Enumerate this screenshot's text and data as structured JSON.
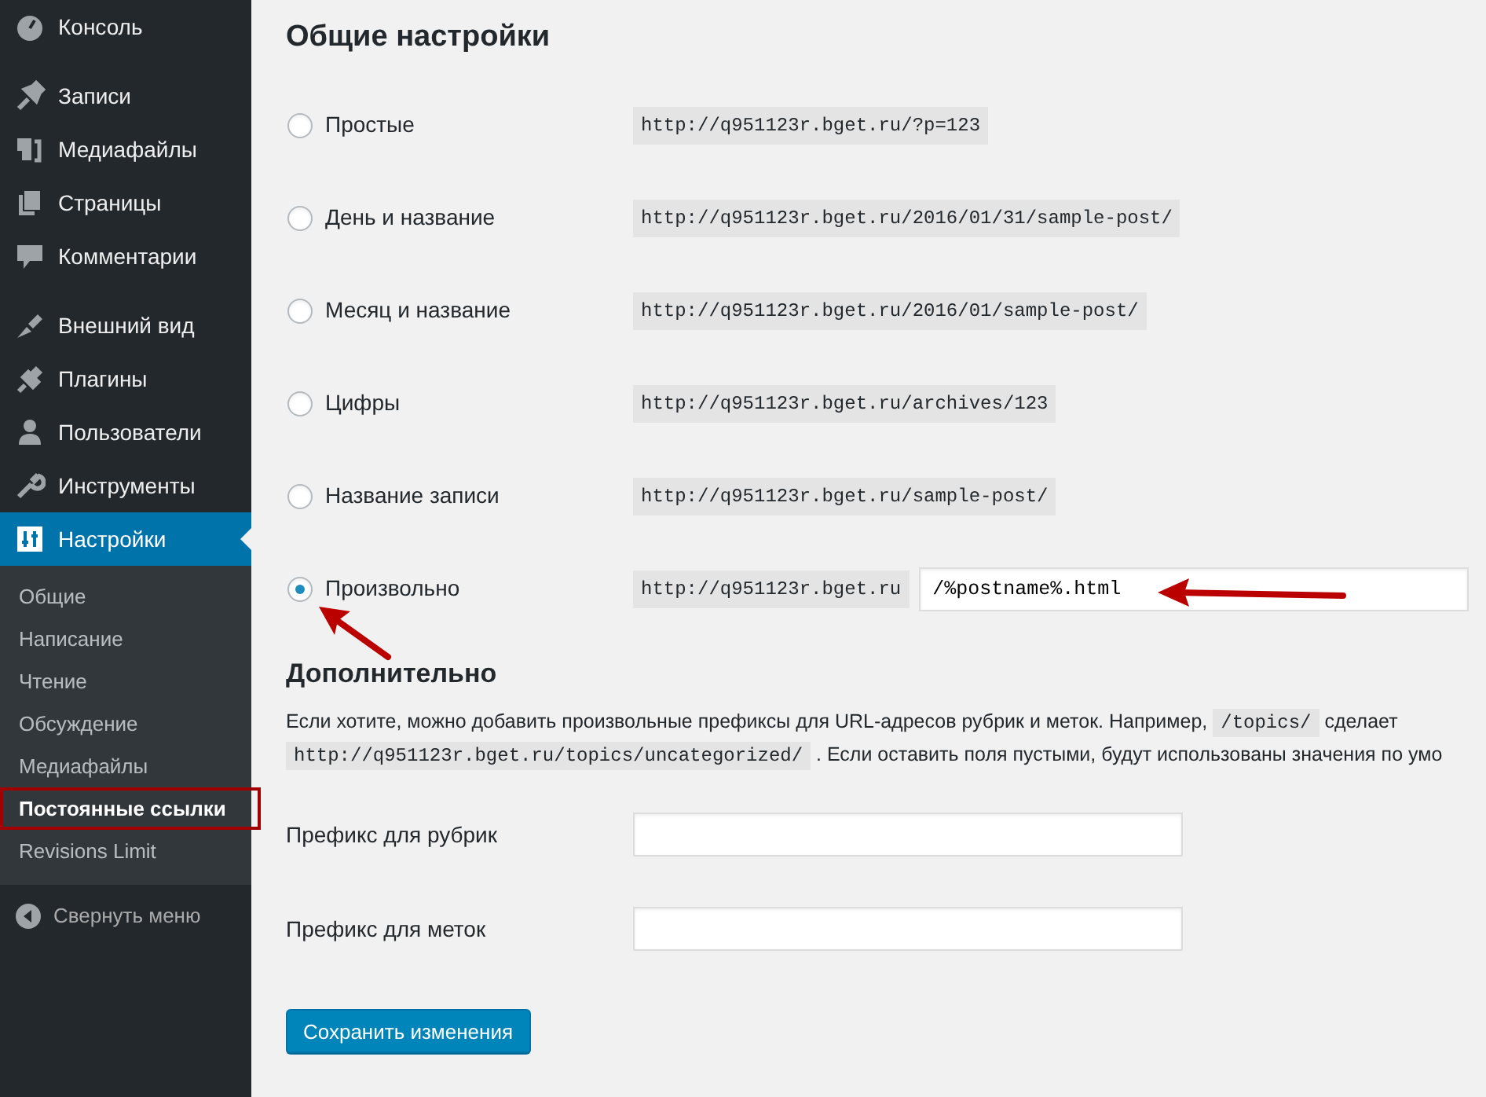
{
  "sidebar": {
    "menu_groups": [
      [
        {
          "label": "Консоль",
          "selected": false
        }
      ],
      [
        {
          "label": "Записи",
          "selected": false
        },
        {
          "label": "Медиафайлы",
          "selected": false
        },
        {
          "label": "Страницы",
          "selected": false
        },
        {
          "label": "Комментарии",
          "selected": false
        }
      ],
      [
        {
          "label": "Внешний вид",
          "selected": false
        },
        {
          "label": "Плагины",
          "selected": false
        },
        {
          "label": "Пользователи",
          "selected": false
        },
        {
          "label": "Инструменты",
          "selected": false
        },
        {
          "label": "Настройки",
          "selected": true
        }
      ]
    ],
    "submenu": [
      {
        "label": "Общие",
        "selected": false,
        "highlighted": false
      },
      {
        "label": "Написание",
        "selected": false,
        "highlighted": false
      },
      {
        "label": "Чтение",
        "selected": false,
        "highlighted": false
      },
      {
        "label": "Обсуждение",
        "selected": false,
        "highlighted": false
      },
      {
        "label": "Медиафайлы",
        "selected": false,
        "highlighted": false
      },
      {
        "label": "Постоянные ссылки",
        "selected": true,
        "highlighted": true
      },
      {
        "label": "Revisions Limit",
        "selected": false,
        "highlighted": false
      }
    ],
    "collapse_label": "Свернуть меню"
  },
  "common_settings": {
    "title": "Общие настройки",
    "options": [
      {
        "label": "Простые",
        "selected": false,
        "example": "http://q951123r.bget.ru/?p=123"
      },
      {
        "label": "День и название",
        "selected": false,
        "example": "http://q951123r.bget.ru/2016/01/31/sample-post/"
      },
      {
        "label": "Месяц и название",
        "selected": false,
        "example": "http://q951123r.bget.ru/2016/01/sample-post/"
      },
      {
        "label": "Цифры",
        "selected": false,
        "example": "http://q951123r.bget.ru/archives/123"
      },
      {
        "label": "Название записи",
        "selected": false,
        "example": "http://q951123r.bget.ru/sample-post/"
      },
      {
        "label": "Произвольно",
        "selected": true,
        "example": "http://q951123r.bget.ru",
        "value": "/%postname%.html"
      }
    ]
  },
  "optional": {
    "title": "Дополнительно",
    "description_lines": [
      [
        {
          "kind": "text",
          "text": "Если хотите, можно добавить произвольные префиксы для URL-адресов рубрик и меток. Например, "
        },
        {
          "kind": "code",
          "text": "/topics/"
        },
        {
          "kind": "text",
          "text": " сделает"
        }
      ],
      [
        {
          "kind": "code",
          "text": "http://q951123r.bget.ru/topics/uncategorized/"
        },
        {
          "kind": "text",
          "text": " . Если оставить поля пустыми, будут использованы значения по умо"
        }
      ]
    ],
    "fields": [
      {
        "label": "Префикс для рубрик"
      },
      {
        "label": "Префикс для меток"
      }
    ]
  },
  "save_button": "Сохранить изменения"
}
